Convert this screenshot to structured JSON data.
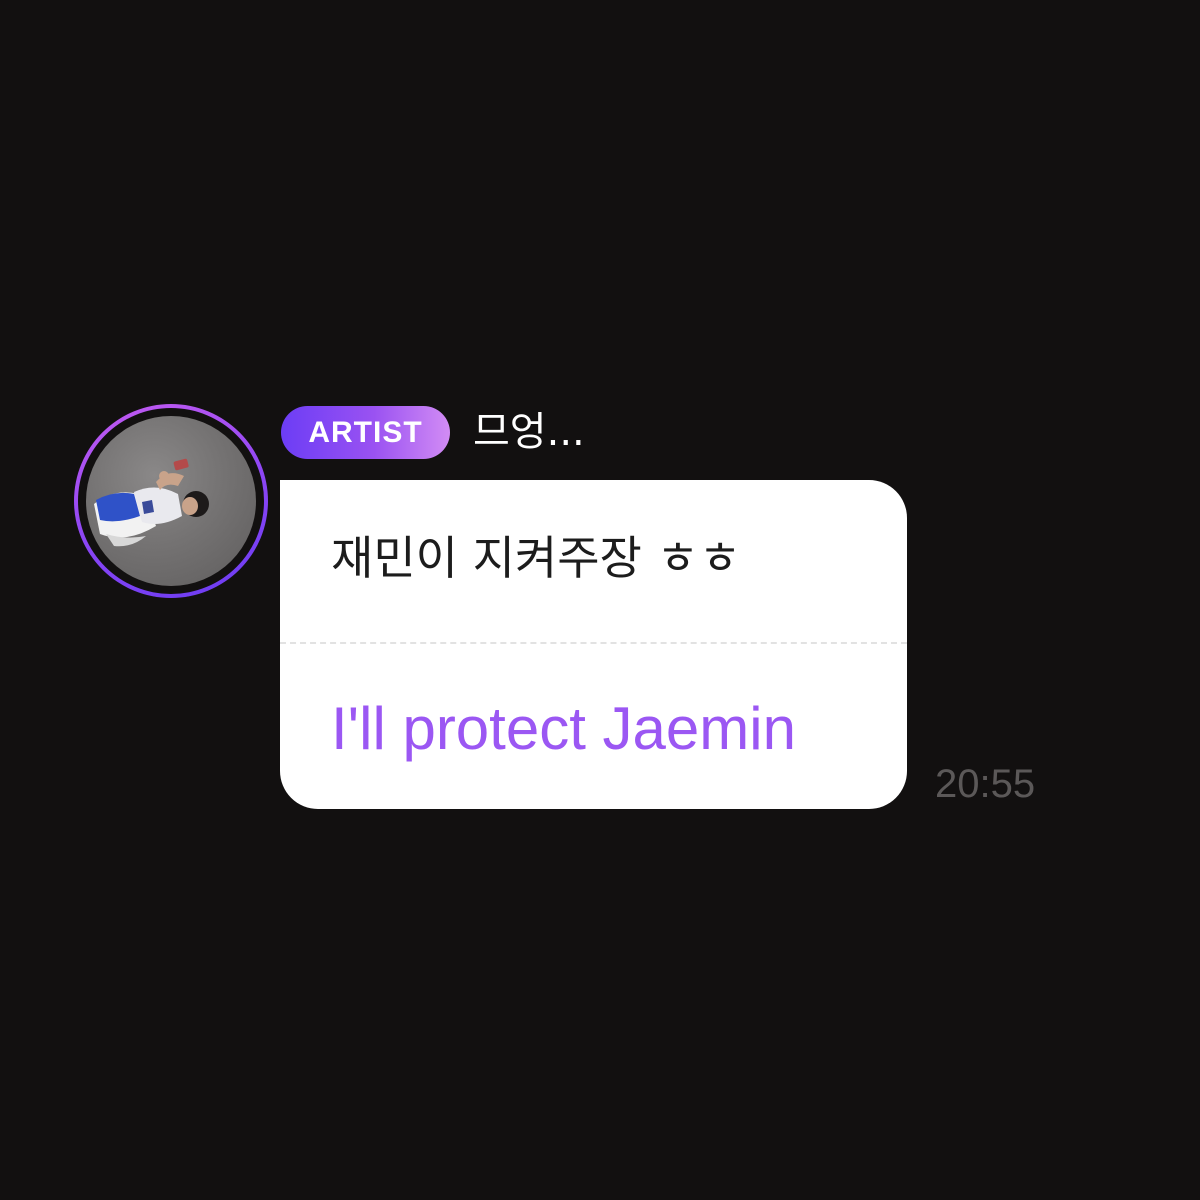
{
  "message": {
    "badge_label": "ARTIST",
    "username": "므엉...",
    "original_text": "재민이 지켜주장 ㅎㅎ",
    "translation_text": "I'll protect Jaemin",
    "time": "20:55"
  },
  "colors": {
    "background": "#121010",
    "badge_gradient_start": "#6c3df5",
    "badge_gradient_end": "#d28cf4",
    "translation": "#9b57f3",
    "timestamp": "#5b5858",
    "bubble": "#ffffff"
  },
  "icons": {
    "avatar": "profile-photo"
  }
}
